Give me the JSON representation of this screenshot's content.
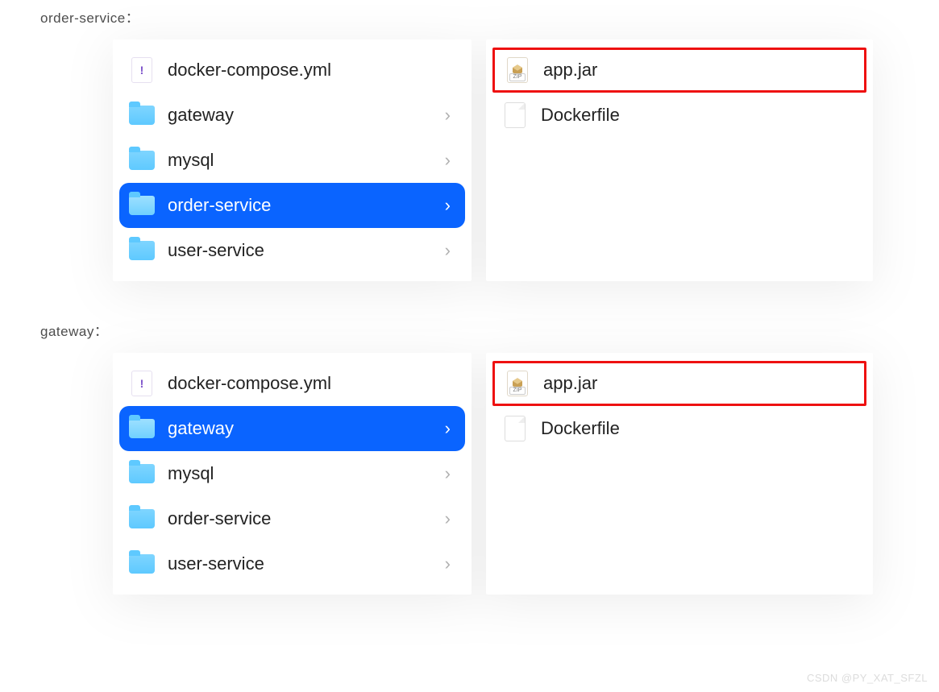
{
  "sections": [
    {
      "label": "order-service：",
      "left_items": [
        {
          "name": "docker-compose.yml",
          "type": "yml",
          "selected": false,
          "has_children": false
        },
        {
          "name": "gateway",
          "type": "folder",
          "selected": false,
          "has_children": true
        },
        {
          "name": "mysql",
          "type": "folder",
          "selected": false,
          "has_children": true
        },
        {
          "name": "order-service",
          "type": "folder",
          "selected": true,
          "has_children": true
        },
        {
          "name": "user-service",
          "type": "folder",
          "selected": false,
          "has_children": true
        }
      ],
      "right_items": [
        {
          "name": "app.jar",
          "type": "zip",
          "highlighted": true
        },
        {
          "name": "Dockerfile",
          "type": "blank",
          "highlighted": false
        }
      ]
    },
    {
      "label": "gateway：",
      "left_items": [
        {
          "name": "docker-compose.yml",
          "type": "yml",
          "selected": false,
          "has_children": false
        },
        {
          "name": "gateway",
          "type": "folder",
          "selected": true,
          "has_children": true
        },
        {
          "name": "mysql",
          "type": "folder",
          "selected": false,
          "has_children": true
        },
        {
          "name": "order-service",
          "type": "folder",
          "selected": false,
          "has_children": true
        },
        {
          "name": "user-service",
          "type": "folder",
          "selected": false,
          "has_children": true
        }
      ],
      "right_items": [
        {
          "name": "app.jar",
          "type": "zip",
          "highlighted": true
        },
        {
          "name": "Dockerfile",
          "type": "blank",
          "highlighted": false
        }
      ]
    }
  ],
  "watermark": "CSDN @PY_XAT_SFZL"
}
